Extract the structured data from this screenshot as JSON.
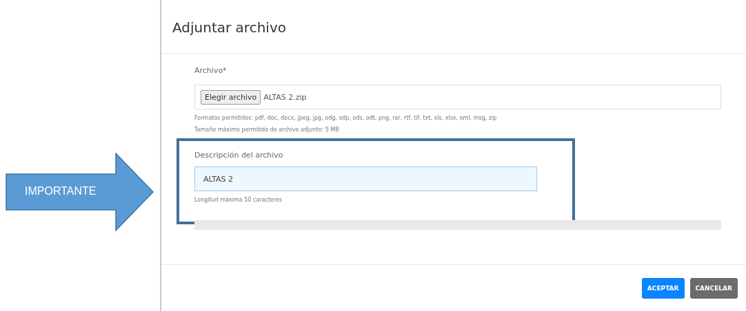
{
  "callout": {
    "label": "IMPORTANTE"
  },
  "dialog": {
    "title": "Adjuntar archivo",
    "file_field": {
      "label": "Archivo*",
      "button": "Elegir archivo",
      "value": "ALTAS 2.zip",
      "hints": [
        "Formatos permitidos: pdf, doc, docx, jpeg, jpg, odg, odp, ods, odt, png, rar, rtf, tif, txt, xls, xlsx, eml, msg, zip",
        "Tamaño máximo permitido de archivo adjunto: 5 MB"
      ]
    },
    "description_field": {
      "label": "Descripción del archivo",
      "value": "ALTAS 2",
      "focused": true,
      "hint": "Longitud máxima 50 caracteres"
    },
    "buttons": [
      {
        "label": "ACEPTAR",
        "kind": "primary"
      },
      {
        "label": "CANCELAR",
        "kind": "secondary"
      }
    ]
  }
}
